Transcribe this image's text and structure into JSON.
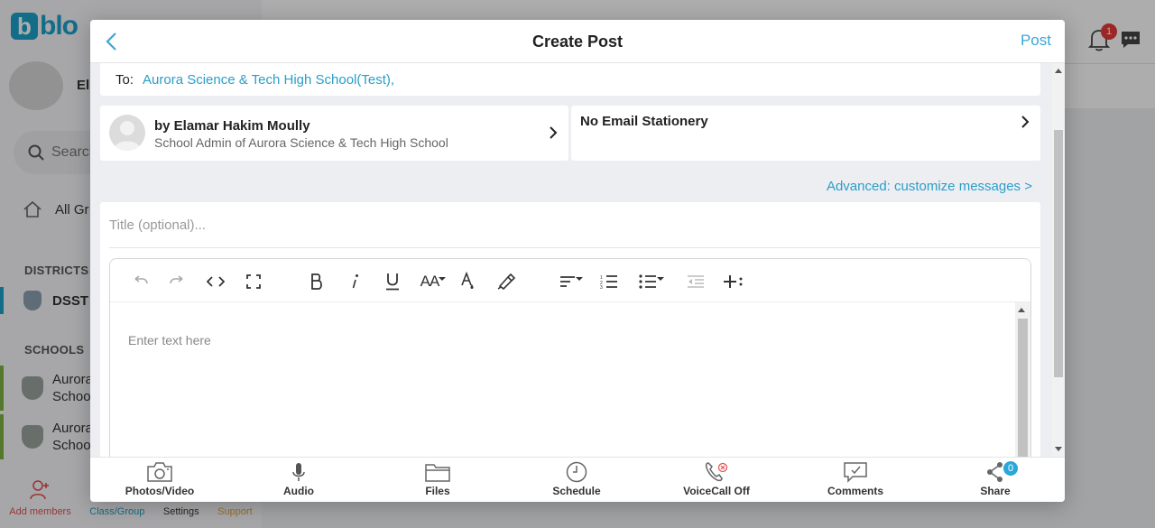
{
  "background": {
    "logo_letter": "b",
    "logo_text": "blo",
    "profile_name": "El",
    "search_placeholder": "Search",
    "all_groups": "All Gr",
    "districts_label": "DISTRICTS",
    "district_name": "DSST",
    "schools_label": "SCHOOLS",
    "schools": [
      {
        "line1": "Aurora",
        "line2": "Schoo"
      },
      {
        "line1": "Aurora",
        "line2": "Schoo"
      }
    ],
    "bottom_nav": {
      "add_members": "Add members",
      "class_group": "Class/Group",
      "settings": "Settings",
      "support": "Support"
    },
    "notification_count": "1"
  },
  "modal": {
    "title": "Create Post",
    "post_label": "Post",
    "to_label": "To:",
    "to_value": "Aurora Science & Tech High School(Test),",
    "author_name": "by Elamar Hakim Moully",
    "author_role": "School Admin of Aurora Science & Tech High School",
    "stationery": "No Email Stationery",
    "advanced_link": "Advanced: customize messages >",
    "title_placeholder": "Title (optional)...",
    "editor_placeholder": "Enter text here"
  },
  "toolbar": {
    "font_size_label": "AA"
  },
  "bottom_bar": {
    "items": [
      {
        "label": "Photos/Video",
        "icon": "camera-icon"
      },
      {
        "label": "Audio",
        "icon": "microphone-icon"
      },
      {
        "label": "Files",
        "icon": "folder-icon"
      },
      {
        "label": "Schedule",
        "icon": "clock-icon"
      },
      {
        "label": "VoiceCall Off",
        "icon": "phone-off-icon"
      },
      {
        "label": "Comments",
        "icon": "comment-icon"
      },
      {
        "label": "Share",
        "icon": "share-icon"
      }
    ],
    "share_count": "0"
  },
  "colors": {
    "accent": "#2a9ec9",
    "notification": "#e53935",
    "school_marker": "#7cb342"
  }
}
